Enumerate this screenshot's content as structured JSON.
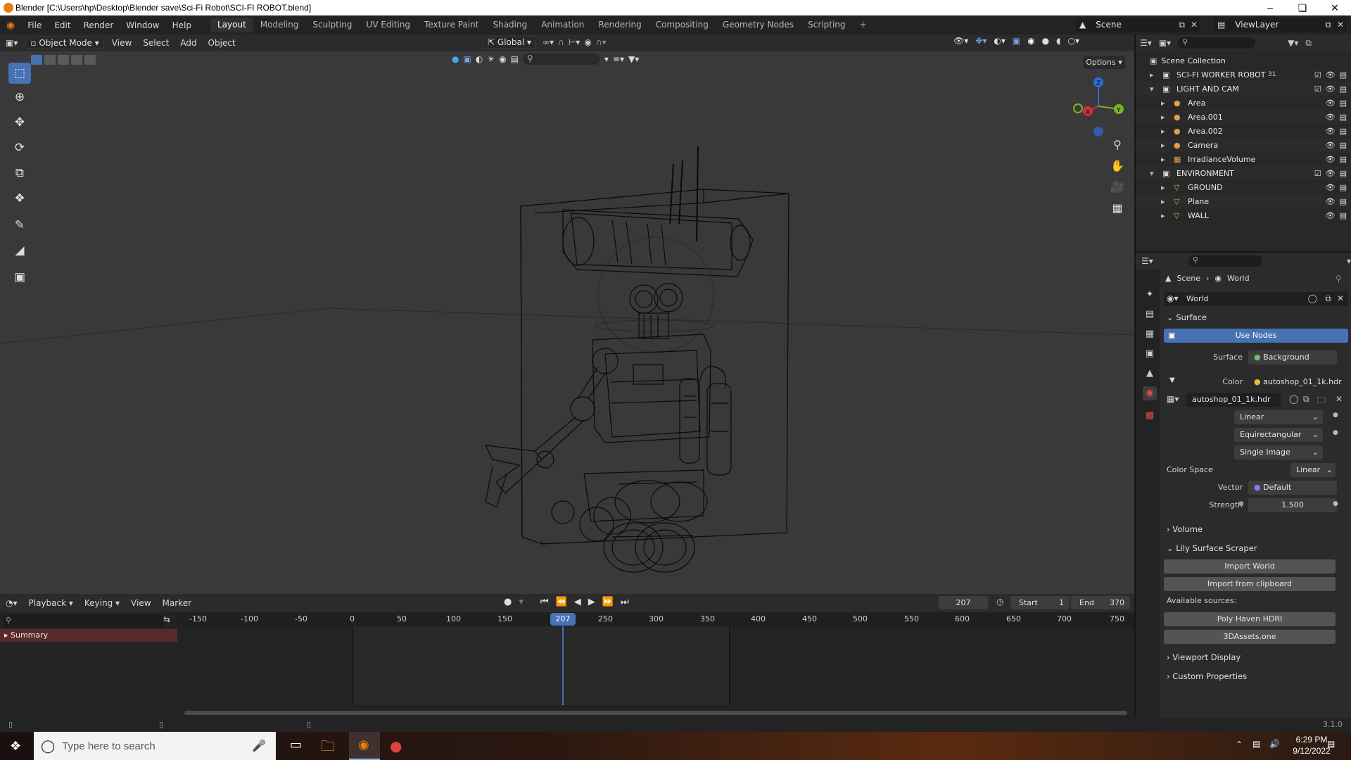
{
  "window": {
    "title": "Blender [C:\\Users\\hp\\Desktop\\Blender save\\Sci-Fi Robot\\SCI-FI ROBOT.blend]"
  },
  "menu": [
    "File",
    "Edit",
    "Render",
    "Window",
    "Help"
  ],
  "workspaces": [
    "Layout",
    "Modeling",
    "Sculpting",
    "UV Editing",
    "Texture Paint",
    "Shading",
    "Animation",
    "Rendering",
    "Compositing",
    "Geometry Nodes",
    "Scripting"
  ],
  "scene": {
    "name": "Scene",
    "viewlayer": "ViewLayer"
  },
  "viewport_header": {
    "mode": "Object Mode",
    "menus": [
      "View",
      "Select",
      "Add",
      "Object"
    ],
    "orientation": "Global",
    "options": "Options"
  },
  "outliner": {
    "root": "Scene Collection",
    "rows": [
      {
        "name": "SCI-FI WORKER ROBOT",
        "level": 0,
        "type": "collection",
        "badge": "31"
      },
      {
        "name": "LIGHT AND CAM",
        "level": 0,
        "type": "collection"
      },
      {
        "name": "Area",
        "level": 1,
        "type": "light"
      },
      {
        "name": "Area.001",
        "level": 1,
        "type": "light"
      },
      {
        "name": "Area.002",
        "level": 1,
        "type": "light"
      },
      {
        "name": "Camera",
        "level": 1,
        "type": "camera"
      },
      {
        "name": "IrradianceVolume",
        "level": 1,
        "type": "probe"
      },
      {
        "name": "ENVIRONMENT",
        "level": 0,
        "type": "collection"
      },
      {
        "name": "GROUND",
        "level": 1,
        "type": "mesh"
      },
      {
        "name": "Plane",
        "level": 1,
        "type": "mesh"
      },
      {
        "name": "WALL",
        "level": 1,
        "type": "mesh"
      }
    ]
  },
  "properties": {
    "breadcrumb": [
      "Scene",
      "World"
    ],
    "world_name": "World",
    "surface_section": "Surface",
    "use_nodes": "Use Nodes",
    "surface_label": "Surface",
    "surface_value": "Background",
    "color_label": "Color",
    "color_value": "autoshop_01_1k.hdr",
    "image_name": "autoshop_01_1k.hdr",
    "interpolation": "Linear",
    "projection": "Equirectangular",
    "source": "Single Image",
    "color_space_label": "Color Space",
    "color_space_value": "Linear",
    "vector_label": "Vector",
    "vector_value": "Default",
    "strength_label": "Strength",
    "strength_value": "1.500",
    "volume_section": "Volume",
    "lily_section": "Lily Surface Scraper",
    "import_world": "Import World",
    "import_clipboard": "Import from clipboard",
    "available_sources": "Available sources:",
    "source1": "Poly Haven HDRI",
    "source2": "3DAssets.one",
    "viewport_display": "Viewport Display",
    "custom_properties": "Custom Properties"
  },
  "timeline": {
    "menus": [
      "Playback",
      "Keying",
      "View",
      "Marker"
    ],
    "current_frame": "207",
    "start_label": "Start",
    "start": "1",
    "end_label": "End",
    "end": "370",
    "ruler": [
      "-150",
      "-100",
      "-50",
      "0",
      "50",
      "100",
      "150",
      "200",
      "250",
      "300",
      "350",
      "400",
      "450",
      "500",
      "550",
      "600",
      "650",
      "700",
      "750"
    ],
    "summary": "Summary"
  },
  "status": {
    "version": "3.1.0"
  },
  "taskbar": {
    "search_placeholder": "Type here to search",
    "time": "6:29 PM",
    "date": "9/12/2022"
  },
  "colors": {
    "accent": "#4772b3",
    "robot_wire": "#050505",
    "viewport_bg": "#393939",
    "playhead": "#4772b3"
  }
}
